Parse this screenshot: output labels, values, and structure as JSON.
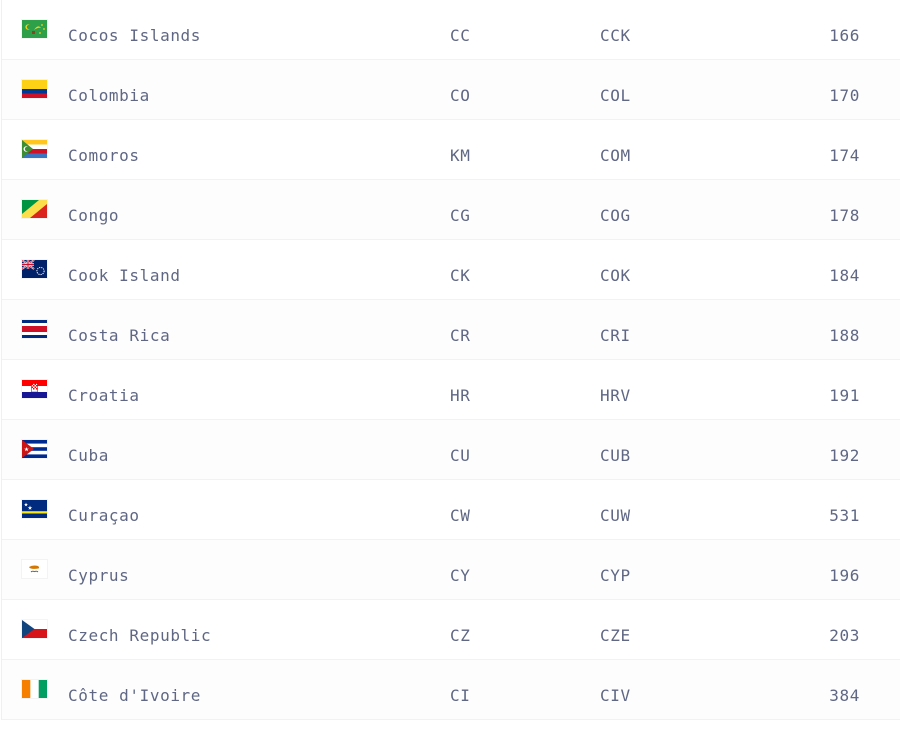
{
  "countries": [
    {
      "name": "Cocos Islands",
      "alpha2": "CC",
      "alpha3": "CCK",
      "numeric": "166",
      "flag_icon": "cocos-islands-flag-icon"
    },
    {
      "name": "Colombia",
      "alpha2": "CO",
      "alpha3": "COL",
      "numeric": "170",
      "flag_icon": "colombia-flag-icon"
    },
    {
      "name": "Comoros",
      "alpha2": "KM",
      "alpha3": "COM",
      "numeric": "174",
      "flag_icon": "comoros-flag-icon"
    },
    {
      "name": "Congo",
      "alpha2": "CG",
      "alpha3": "COG",
      "numeric": "178",
      "flag_icon": "congo-flag-icon"
    },
    {
      "name": "Cook Island",
      "alpha2": "CK",
      "alpha3": "COK",
      "numeric": "184",
      "flag_icon": "cook-islands-flag-icon"
    },
    {
      "name": "Costa Rica",
      "alpha2": "CR",
      "alpha3": "CRI",
      "numeric": "188",
      "flag_icon": "costa-rica-flag-icon"
    },
    {
      "name": "Croatia",
      "alpha2": "HR",
      "alpha3": "HRV",
      "numeric": "191",
      "flag_icon": "croatia-flag-icon"
    },
    {
      "name": "Cuba",
      "alpha2": "CU",
      "alpha3": "CUB",
      "numeric": "192",
      "flag_icon": "cuba-flag-icon"
    },
    {
      "name": "Curaçao",
      "alpha2": "CW",
      "alpha3": "CUW",
      "numeric": "531",
      "flag_icon": "curacao-flag-icon"
    },
    {
      "name": "Cyprus",
      "alpha2": "CY",
      "alpha3": "CYP",
      "numeric": "196",
      "flag_icon": "cyprus-flag-icon"
    },
    {
      "name": "Czech Republic",
      "alpha2": "CZ",
      "alpha3": "CZE",
      "numeric": "203",
      "flag_icon": "czech-republic-flag-icon"
    },
    {
      "name": "Côte d'Ivoire",
      "alpha2": "CI",
      "alpha3": "CIV",
      "numeric": "384",
      "flag_icon": "cote-divoire-flag-icon"
    }
  ],
  "colors": {
    "text": "#5f6784",
    "row_border": "#f0f2f7"
  }
}
